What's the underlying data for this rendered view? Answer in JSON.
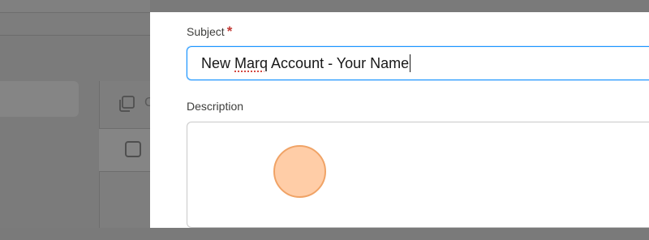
{
  "form": {
    "subject_label": "Subject",
    "required_symbol": "*",
    "subject_value_prefix": "New ",
    "subject_value_misspelled": "Marq",
    "subject_value_suffix": " Account - Your Name",
    "description_label": "Description",
    "description_value": ""
  },
  "backdrop": {
    "partial_text": "C"
  },
  "colors": {
    "focus_border": "#1b96ff",
    "required": "#c23934",
    "overlay": "#7a7a7a",
    "click_indicator": "#ffc498"
  },
  "icons": {
    "copy": "copy-icon",
    "checkbox": "checkbox-icon"
  }
}
